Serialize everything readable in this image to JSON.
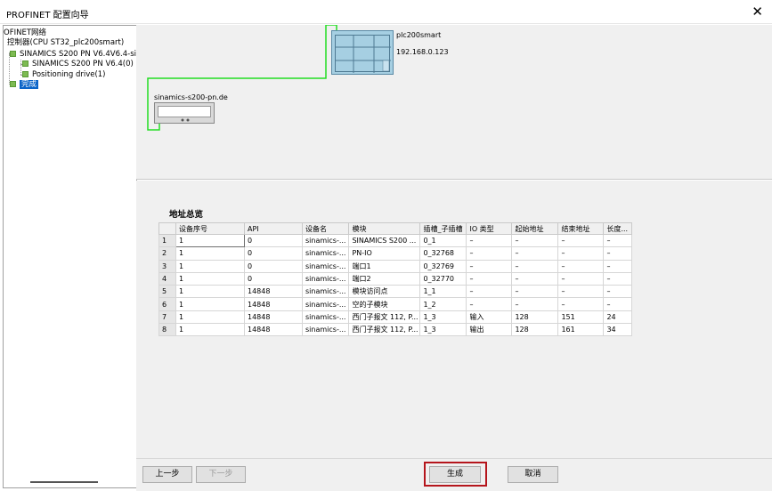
{
  "window": {
    "title": "PROFINET 配置向导",
    "close_glyph": "✕"
  },
  "tree": {
    "root_label": "OFINET网络",
    "controller_label": "控制器(CPU ST32_plc200smart)",
    "device_label": "SINAMICS S200 PN V6.4V6.4-sinan",
    "submodule_label": "SINAMICS S200 PN V6.4(0)",
    "positioning_label": "Positioning drive(1)",
    "finish_label": "完成"
  },
  "topology": {
    "plc_name": "plc200smart",
    "plc_ip": "192.168.0.123",
    "drive_name": "sinamics-s200-pn.de",
    "link_color": "#22dd22"
  },
  "overview": {
    "title": "地址总览",
    "columns": [
      "设备序号",
      "API",
      "设备名",
      "模块",
      "插槽_子插槽",
      "IO 类型",
      "起始地址",
      "结束地址",
      "长度..."
    ],
    "rows": [
      [
        "1",
        "1",
        "0",
        "sinamics-...",
        "SINAMICS S200 ...",
        "0_1",
        "–",
        "–",
        "–",
        "–"
      ],
      [
        "2",
        "1",
        "0",
        "sinamics-...",
        "PN-IO",
        "0_32768",
        "–",
        "–",
        "–",
        "–"
      ],
      [
        "3",
        "1",
        "0",
        "sinamics-...",
        "端口1",
        "0_32769",
        "–",
        "–",
        "–",
        "–"
      ],
      [
        "4",
        "1",
        "0",
        "sinamics-...",
        "端口2",
        "0_32770",
        "–",
        "–",
        "–",
        "–"
      ],
      [
        "5",
        "1",
        "14848",
        "sinamics-...",
        "模块访问点",
        "1_1",
        "–",
        "–",
        "–",
        "–"
      ],
      [
        "6",
        "1",
        "14848",
        "sinamics-...",
        "空的子模块",
        "1_2",
        "–",
        "–",
        "–",
        "–"
      ],
      [
        "7",
        "1",
        "14848",
        "sinamics-...",
        "西门子报文 112, P...",
        "1_3",
        "输入",
        "128",
        "151",
        "24"
      ],
      [
        "8",
        "1",
        "14848",
        "sinamics-...",
        "西门子报文 112, P...",
        "1_3",
        "输出",
        "128",
        "161",
        "34"
      ]
    ]
  },
  "buttons": {
    "prev": "上一步",
    "next": "下一步",
    "generate": "生成",
    "cancel": "取消",
    "highlight_color": "#b5151c"
  }
}
